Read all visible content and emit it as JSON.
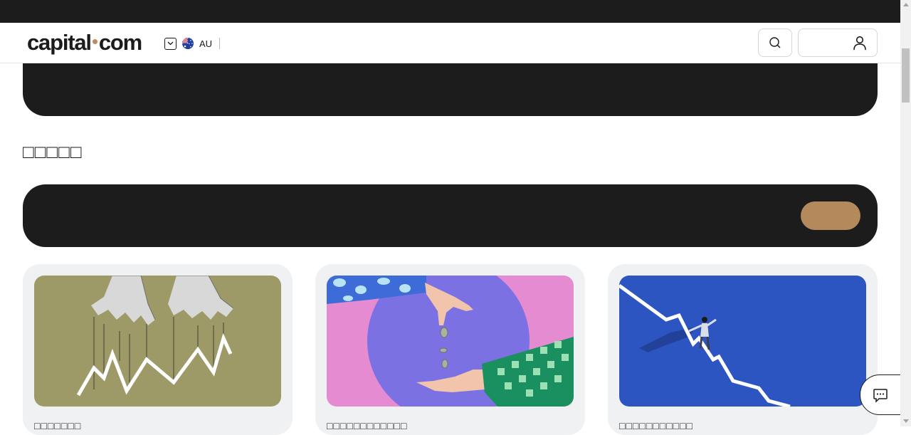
{
  "topbar": {},
  "header": {
    "logo": {
      "left": "capital",
      "right": "com"
    },
    "region": {
      "code": "AU",
      "flag_icon": "australia-flag-icon"
    },
    "search_icon": "search-icon",
    "user_icon": "user-icon"
  },
  "section": {
    "title": "□□□□□"
  },
  "cards": [
    {
      "caption": "□□□□□□□",
      "image": "puppet-hands-chart"
    },
    {
      "caption": "□□□□□□□□□□□□",
      "image": "coins-falling-hands"
    },
    {
      "caption": "□□□□□□□□□□□",
      "image": "man-walking-declining-line"
    }
  ],
  "chat": {
    "icon": "chat-icon"
  },
  "colors": {
    "dark": "#1c1c1d",
    "accent": "#b48a5d",
    "card_bg": "#f0f1f3",
    "olive": "#9e9a68",
    "pink": "#e48bd2",
    "purple": "#7c71e2",
    "blue": "#2d55c2"
  }
}
